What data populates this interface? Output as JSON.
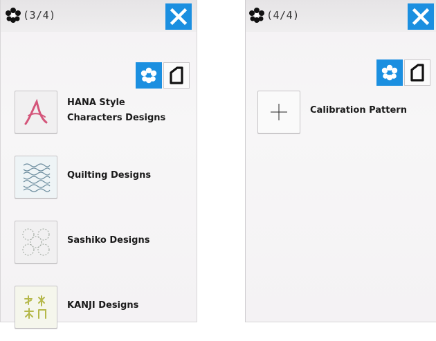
{
  "left_panel": {
    "title": "(3/4)",
    "items": [
      {
        "line1": "HANA Style",
        "line2": "Characters Designs",
        "icon": "hana-a-icon"
      },
      {
        "label": "Quilting Designs",
        "icon": "quilting-pattern-icon"
      },
      {
        "label": "Sashiko Designs",
        "icon": "sashiko-pattern-icon"
      },
      {
        "label": "KANJI Designs",
        "icon": "kanji-icon"
      }
    ]
  },
  "right_panel": {
    "title": "(4/4)",
    "items": [
      {
        "label": "Calibration Pattern",
        "icon": "crosshair-icon"
      }
    ]
  },
  "colors": {
    "accent": "#1b8fe0",
    "panel_bg": "#f5f4f5",
    "titlebar_bg": "#e9e8e9"
  }
}
